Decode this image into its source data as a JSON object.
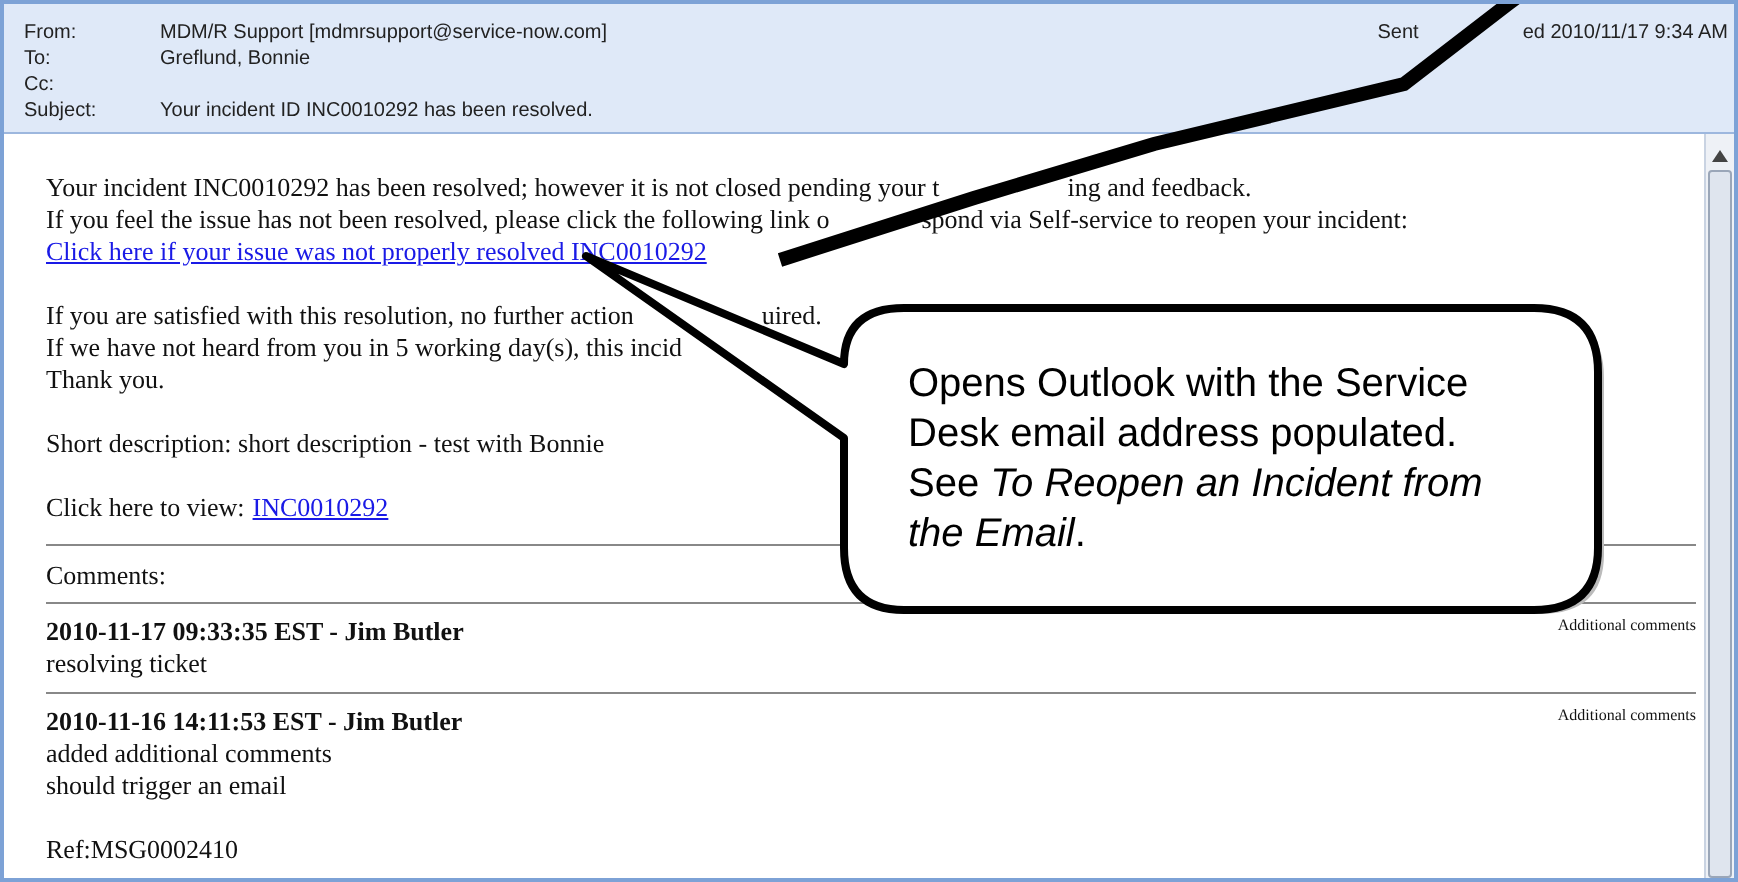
{
  "header": {
    "fields": [
      {
        "label": "From:",
        "value": "MDM/R Support [mdmrsupport@service-now.com]"
      },
      {
        "label": "To:",
        "value": "Greflund, Bonnie"
      },
      {
        "label": "Cc:"
      },
      {
        "label": "Subject:",
        "value": "Your incident ID INC0010292 has been resolved."
      }
    ],
    "sent": {
      "label": "Sent",
      "value": "ed 2010/11/17 9:34 AM"
    }
  },
  "body": {
    "lines": [
      {
        "kind": "text",
        "fragments": [
          "Your incident INC0010292 has been resolved; however it is not closed pending your t",
          "ing and feedback."
        ]
      },
      {
        "kind": "text",
        "fragments": [
          "If you feel the issue has not been resolved, please click the following link o",
          "spond via Self-service to reopen your incident:"
        ]
      },
      {
        "kind": "link",
        "text": "Click here if your issue was not properly resolved INC0010292"
      },
      {
        "kind": "blank"
      },
      {
        "kind": "text",
        "fragments": [
          "If you are satisfied with this resolution, no further action",
          "uired."
        ]
      },
      {
        "kind": "text",
        "fragments": [
          "If we have not heard from you in 5 working day(s), this incid"
        ]
      },
      {
        "kind": "text",
        "fragments": [
          "Thank you."
        ]
      },
      {
        "kind": "blank"
      },
      {
        "kind": "text",
        "fragments": [
          "Short description: short description - test with Bonnie"
        ]
      },
      {
        "kind": "blank"
      },
      {
        "kind": "labeled_link",
        "label": "Click here to view:",
        "text": "INC0010292"
      }
    ]
  },
  "comments": {
    "title": "Comments:",
    "entries": [
      {
        "heading": "2010-11-17 09:33:35 EST - Jim Butler",
        "type": "Additional comments",
        "lines": [
          "resolving ticket"
        ]
      },
      {
        "heading": "2010-11-16 14:11:53 EST - Jim Butler",
        "type": "Additional comments",
        "lines": [
          "added additional comments",
          "should trigger an email"
        ]
      }
    ],
    "ref": "Ref:MSG0002410"
  },
  "callout": {
    "text": "Opens Outlook with the Service Desk email address populated. See *To Reopen an Incident from the Email*."
  }
}
